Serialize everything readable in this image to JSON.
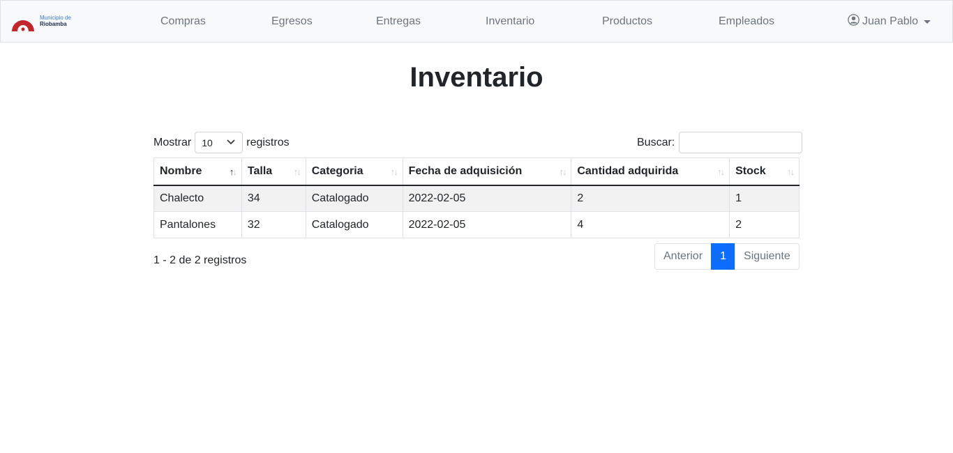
{
  "brand": {
    "line1": "Municipio de",
    "line2": "Riobamba",
    "logo_icon": "municipio-logo-icon",
    "accent": "#c0282d"
  },
  "nav": {
    "items": [
      "Compras",
      "Egresos",
      "Entregas",
      "Inventario",
      "Productos",
      "Empleados"
    ],
    "user": "Juan Pablo",
    "user_icon": "user-circle-icon"
  },
  "page": {
    "title": "Inventario"
  },
  "controls": {
    "length_prefix": "Mostrar",
    "length_value": "10",
    "length_suffix": "registros",
    "search_label": "Buscar:",
    "search_value": ""
  },
  "table": {
    "columns": [
      "Nombre",
      "Talla",
      "Categoria",
      "Fecha de adquisición",
      "Cantidad adquirida",
      "Stock"
    ],
    "sorted_column": "Nombre",
    "sort_direction": "asc",
    "rows": [
      [
        "Chalecto",
        "34",
        "Catalogado",
        "2022-02-05",
        "2",
        "1"
      ],
      [
        "Pantalones",
        "32",
        "Catalogado",
        "2022-02-05",
        "4",
        "2"
      ]
    ]
  },
  "footer": {
    "info": "1 - 2 de 2 registros",
    "prev": "Anterior",
    "page": "1",
    "next": "Siguiente"
  },
  "colors": {
    "primary": "#0d6efd",
    "navbar_bg": "#f8f9fa",
    "stripe": "#f2f2f2"
  }
}
